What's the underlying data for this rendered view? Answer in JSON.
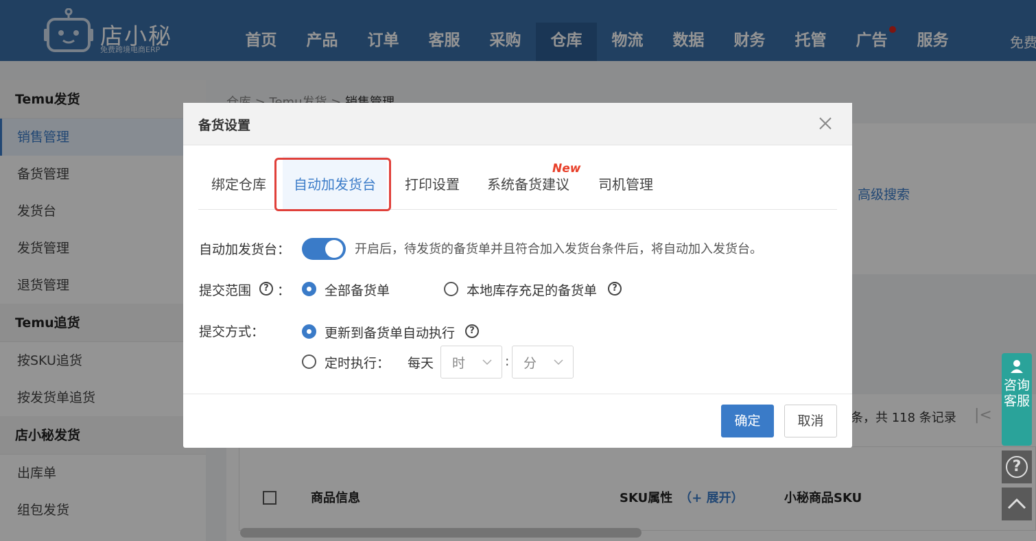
{
  "header": {
    "brand": "店小秘",
    "slogan": "免费跨境电商ERP",
    "nav": [
      "首页",
      "产品",
      "订单",
      "客服",
      "采购",
      "仓库",
      "物流",
      "数据",
      "财务",
      "托管",
      "广告",
      "服务"
    ],
    "active_nav": "仓库",
    "right_text": "免费"
  },
  "sidebar": {
    "group1": "Temu发货",
    "group1_items": [
      "销售管理",
      "备货管理",
      "发货台",
      "发货管理",
      "退货管理"
    ],
    "group2": "Temu追货",
    "group2_items": [
      "按SKU追货",
      "按发货单追货"
    ],
    "group3": "店小秘发货",
    "group3_items": [
      "出库单",
      "组包发货"
    ]
  },
  "main": {
    "breadcrumb": [
      "仓库",
      "Temu发货",
      "销售管理"
    ],
    "advanced_search": "高级搜索",
    "records": "条，共 118 条记录",
    "table_headers": {
      "product_info": "商品信息",
      "sku_attr": "SKU属性",
      "expand": "（+ 展开）",
      "dxm_sku": "小秘商品SKU"
    }
  },
  "float": {
    "consult": "咨询客服"
  },
  "modal": {
    "title": "备货设置",
    "tabs": [
      "绑定仓库",
      "自动加发货台",
      "打印设置",
      "系统备货建议",
      "司机管理"
    ],
    "new_badge": "New",
    "auto_label": "自动加发货台：",
    "auto_enabled": true,
    "auto_hint": "开启后，待发货的备货单并且符合加入发货台条件后，将自动加入发货台。",
    "scope_label": "提交范围",
    "scope_colon": "：",
    "scope_options": [
      "全部备货单",
      "本地库存充足的备货单"
    ],
    "scope_selected": "全部备货单",
    "method_label": "提交方式：",
    "method_options": [
      "更新到备货单自动执行",
      "定时执行："
    ],
    "method_selected": "更新到备货单自动执行",
    "every_day": "每天",
    "hour_placeholder": "时",
    "minute_placeholder": "分",
    "time_sep": ":",
    "ok": "确定",
    "cancel": "取消"
  },
  "colors": {
    "header_bg": "#3a6fa8",
    "accent": "#3a7bc8",
    "highlight": "#e0403a",
    "new_badge": "#e8402a",
    "consult_bg": "#2aa39a"
  }
}
